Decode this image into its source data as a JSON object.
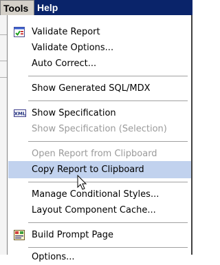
{
  "menubar": {
    "tools_label": "Tools",
    "help_label": "Help"
  },
  "menu": {
    "items": [
      {
        "label": "Validate Report",
        "enabled": true,
        "icon": "validate-report-icon"
      },
      {
        "label": "Validate Options...",
        "enabled": true
      },
      {
        "label": "Auto Correct...",
        "enabled": true
      },
      {
        "label": "Show Generated SQL/MDX",
        "enabled": true
      },
      {
        "label": "Show Specification",
        "enabled": true,
        "icon": "xml-icon"
      },
      {
        "label": "Show Specification (Selection)",
        "enabled": false
      },
      {
        "label": "Open Report from Clipboard",
        "enabled": false
      },
      {
        "label": "Copy Report to Clipboard",
        "enabled": true,
        "highlighted": true
      },
      {
        "label": "Manage Conditional Styles...",
        "enabled": true
      },
      {
        "label": "Layout Component Cache...",
        "enabled": true
      },
      {
        "label": "Build Prompt Page",
        "enabled": true,
        "icon": "build-prompt-page-icon"
      },
      {
        "label": "Options...",
        "enabled": true
      }
    ],
    "xml_icon_text": "XML"
  },
  "colors": {
    "menubar_bg": "#d4d0c8",
    "highlight": "#c1d2ee",
    "active_menu": "#0a246a",
    "disabled_text": "#9a9a9a"
  }
}
